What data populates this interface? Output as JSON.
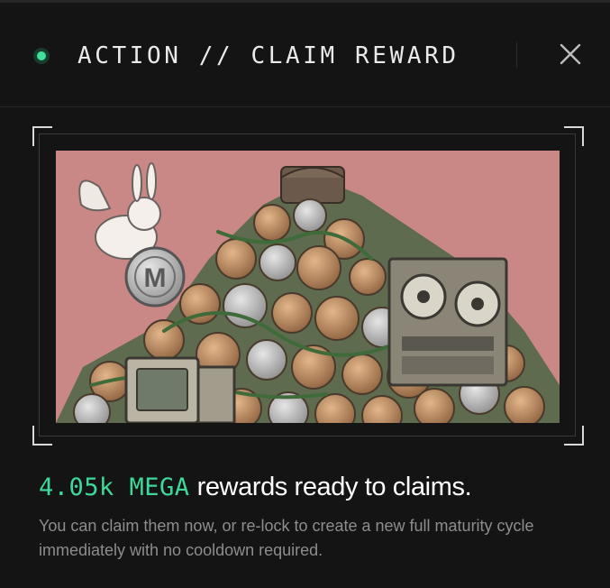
{
  "dialog": {
    "title": "ACTION // CLAIM REWARD",
    "status_color": "#3fe09a",
    "close_icon": "close-icon"
  },
  "illustration": {
    "subject": "pile of coins with winged bunny, M coin, retro monitor and reel-to-reel tape deck",
    "background_color": "#c98886",
    "coin_letter": "M"
  },
  "rewards": {
    "amount": "4.05k MEGA",
    "headline": "rewards ready to claims.",
    "description": "You can claim them now, or re-lock to create a new full maturity cycle immediately with no cooldown required.",
    "accent_color": "#3ed99a"
  }
}
